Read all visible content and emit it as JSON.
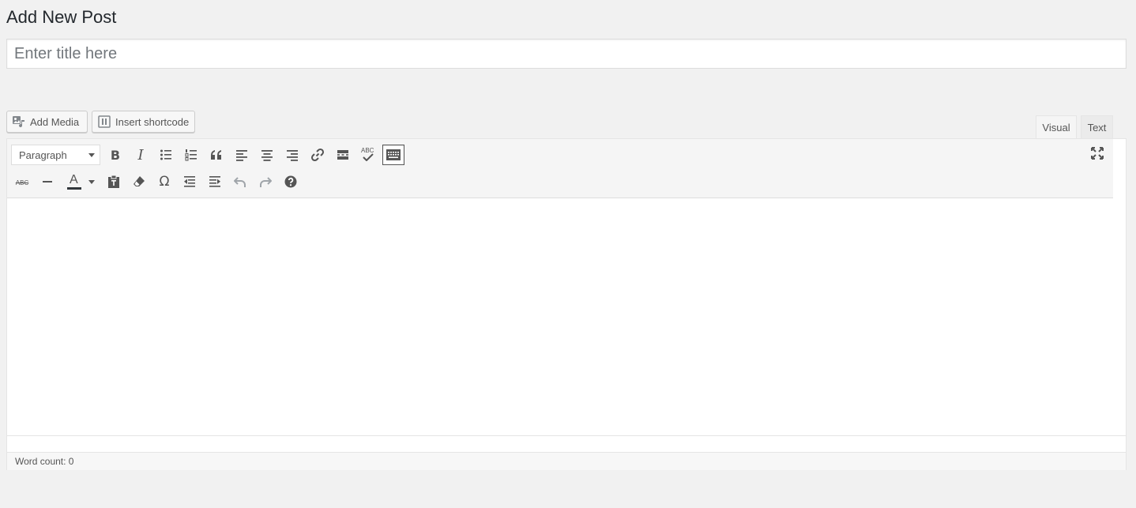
{
  "page": {
    "title": "Add New Post"
  },
  "title_field": {
    "value": "",
    "placeholder": "Enter title here"
  },
  "media_buttons": {
    "add_media": "Add Media",
    "insert_shortcode": "Insert shortcode"
  },
  "editor_tabs": {
    "visual": "Visual",
    "text": "Text",
    "active": "visual"
  },
  "toolbar": {
    "format_select": "Paragraph",
    "row1": [
      "bold-icon",
      "italic-icon",
      "bulleted-list-icon",
      "numbered-list-icon",
      "blockquote-icon",
      "align-left-icon",
      "align-center-icon",
      "align-right-icon",
      "link-icon",
      "read-more-icon",
      "spellcheck-icon",
      "toolbar-toggle-icon",
      "fullscreen-icon"
    ],
    "row2": [
      "strikethrough-icon",
      "horizontal-line-icon",
      "text-color-icon",
      "paste-as-text-icon",
      "clear-formatting-icon",
      "special-character-icon",
      "outdent-icon",
      "indent-icon",
      "undo-icon",
      "redo-icon",
      "help-icon"
    ],
    "bold_glyph": "B",
    "italic_glyph": "I",
    "text_color_glyph": "A",
    "strike_glyph": "ABC",
    "spell_glyph": "ABC",
    "omega_glyph": "Ω"
  },
  "status": {
    "word_count": "Word count: 0"
  },
  "colors": {
    "background": "#f1f1f1",
    "toolbar": "#f5f5f5",
    "text": "#555555",
    "disabled": "#a0a5aa"
  }
}
